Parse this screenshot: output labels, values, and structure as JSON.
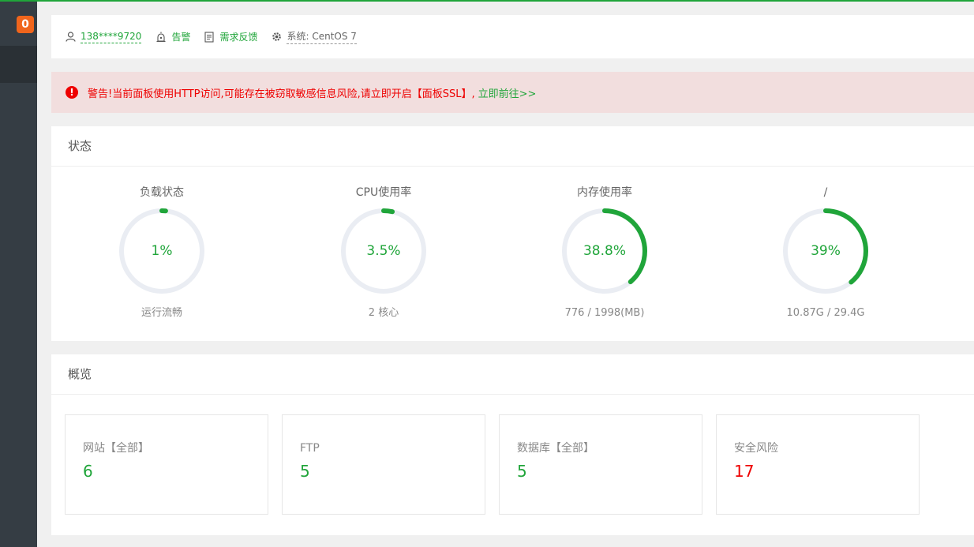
{
  "sidebar": {
    "badge": "0"
  },
  "header": {
    "user": "138****9720",
    "alarm": "告警",
    "feedback": "需求反馈",
    "system": "系统:  CentOS 7"
  },
  "alert": {
    "icon": "!",
    "message": "警告!当前面板使用HTTP访问,可能存在被窃取敏感信息风险,请立即开启【面板SSL】,",
    "link": "立即前往>>"
  },
  "status": {
    "title": "状态",
    "gauges": [
      {
        "title": "负载状态",
        "value": "1%",
        "percent": 1,
        "sub": "运行流畅"
      },
      {
        "title": "CPU使用率",
        "value": "3.5%",
        "percent": 3.5,
        "sub": "2 核心"
      },
      {
        "title": "内存使用率",
        "value": "38.8%",
        "percent": 38.8,
        "sub": "776 / 1998(MB)"
      },
      {
        "title": "/",
        "value": "39%",
        "percent": 39,
        "sub": "10.87G / 29.4G"
      }
    ]
  },
  "overview": {
    "title": "概览",
    "cards": [
      {
        "label": "网站【全部】",
        "value": "6"
      },
      {
        "label": "FTP",
        "value": "5"
      },
      {
        "label": "数据库【全部】",
        "value": "5"
      },
      {
        "label": "安全风险",
        "value": "17"
      }
    ]
  },
  "colors": {
    "accent": "#20a53a",
    "danger": "#ee0000",
    "ring_track": "#eaedf3"
  }
}
